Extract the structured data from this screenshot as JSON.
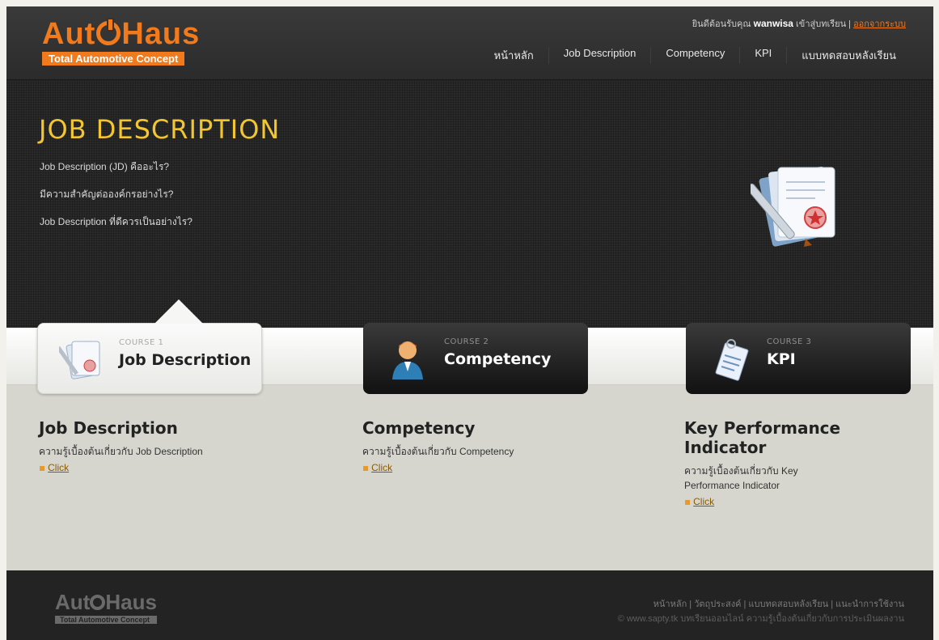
{
  "header": {
    "logo_word": "Aut",
    "logo_word2": "Haus",
    "logo_tagline": "Total Automotive Concept",
    "welcome_prefix": "ยินดีต้อนรับคุณ",
    "username": "wanwisa",
    "welcome_suffix": "เข้าสู่บทเรียน |",
    "logout_label": "ออกจากระบบ",
    "nav": [
      "หน้าหลัก",
      "Job Description",
      "Competency",
      "KPI",
      "แบบทดสอบหลังเรียน"
    ]
  },
  "hero": {
    "title": "JOB DESCRIPTION",
    "questions": [
      "Job Description (JD) คืออะไร?",
      "มีความสำคัญต่อองค์กรอย่างไร?",
      "Job Description ที่ดีควรเป็นอย่างไร?"
    ]
  },
  "courses": [
    {
      "number": "COURSE 1",
      "name": "Job Description",
      "active": true,
      "heading": "Job Description",
      "desc": "ความรู้เบื้องต้นเกี่ยวกับ Job Description",
      "link": "Click"
    },
    {
      "number": "COURSE 2",
      "name": "Competency",
      "active": false,
      "heading": "Competency",
      "desc": "ความรู้เบื้องต้นเกี่ยวกับ Competency",
      "link": "Click"
    },
    {
      "number": "COURSE 3",
      "name": "KPI",
      "active": false,
      "heading": "Key Performance Indicator",
      "desc": "ความรู้เบื้องต้นเกี่ยวกับ Key Performance Indicator",
      "link": "Click"
    }
  ],
  "footer": {
    "logo_word": "Aut",
    "logo_word2": "Haus",
    "logo_tagline": "Total Automotive Concept",
    "links": "หน้าหลัก | วัตถุประสงค์ | แบบทดสอบหลังเรียน | แนะนำการใช้งาน",
    "copyright": "© www.sapty.tk บทเรียนออนไลน์ ความรู้เบื้องต้นเกี่ยวกับการประเมินผลงาน"
  },
  "colors": {
    "brand": "#f07a1c",
    "title": "#f2c531",
    "dark": "#262626",
    "band": "#d6d6cf"
  }
}
